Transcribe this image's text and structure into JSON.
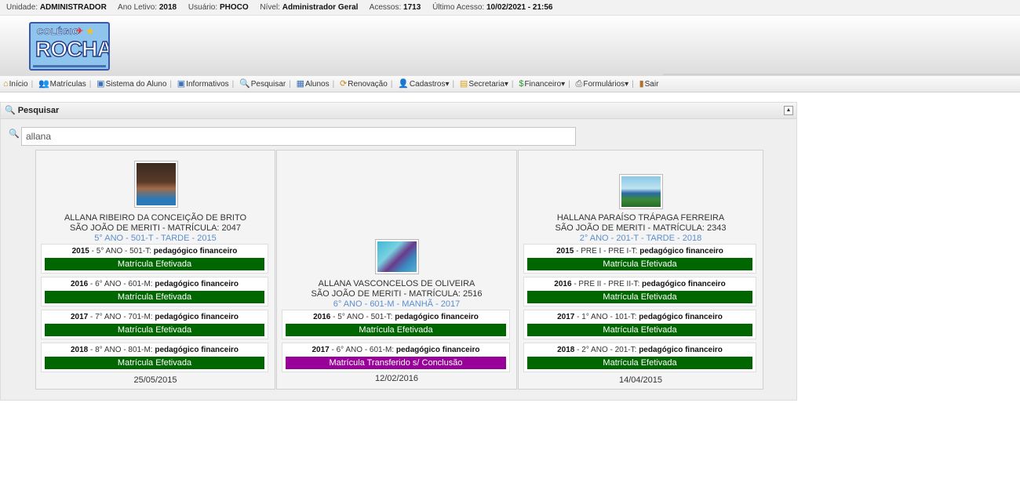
{
  "topbar": {
    "unit_label": "Unidade:",
    "unit": "ADMINISTRADOR",
    "year_label": "Ano Letivo:",
    "year": "2018",
    "user_label": "Usuário:",
    "user": "PHOCO",
    "level_label": "Nível:",
    "level": "Administrador Geral",
    "access_label": "Acessos:",
    "access": "1713",
    "last_label": "Último Acesso:",
    "last": "10/02/2021 - 21:56"
  },
  "logo": {
    "line1": "COLÉGIO",
    "line2": "ROCHA"
  },
  "nav": {
    "inicio": "Início",
    "matriculas": "Matrículas",
    "sistema": "Sistema do Aluno",
    "informativos": "Informativos",
    "pesquisar": "Pesquisar",
    "alunos": "Alunos",
    "renovacao": "Renovação",
    "cadastros": "Cadastros▾",
    "secretaria": "Secretaria▾",
    "financeiro": "Financeiro▾",
    "formularios": "Formulários▾",
    "sair": "Sair"
  },
  "panel": {
    "title": "Pesquisar"
  },
  "search": {
    "value": "allana"
  },
  "colors": {
    "effective": "#006600",
    "transferred": "#990099",
    "class_text": "#5a8ed0"
  },
  "students": [
    {
      "name": "ALLANA RIBEIRO DA CONCEIÇÃO DE BRITO",
      "registration": "SÃO JOÃO DE MERITI - MATRÍCULA: 2047",
      "class": "5° ANO - 501-T - TARDE - 2015",
      "enrollments": [
        {
          "year": "2015",
          "desc": " - 5° ANO - 501-T: ",
          "links": "pedagógico financeiro",
          "status": "Matrícula Efetivada"
        },
        {
          "year": "2016",
          "desc": " - 6° ANO - 601-M: ",
          "links": "pedagógico financeiro",
          "status": "Matrícula Efetivada"
        },
        {
          "year": "2017",
          "desc": " - 7° ANO - 701-M: ",
          "links": "pedagógico financeiro",
          "status": "Matrícula Efetivada"
        },
        {
          "year": "2018",
          "desc": " - 8° ANO - 801-M: ",
          "links": "pedagógico financeiro",
          "status": "Matrícula Efetivada"
        }
      ],
      "date": "25/05/2015"
    },
    {
      "name": "ALLANA VASCONCELOS DE OLIVEIRA",
      "registration": "SÃO JOÃO DE MERITI - MATRÍCULA: 2516",
      "class": "6° ANO - 601-M - MANHÃ - 2017",
      "enrollments": [
        {
          "year": "2016",
          "desc": " - 5° ANO - 501-T: ",
          "links": "pedagógico financeiro",
          "status": "Matrícula Efetivada"
        },
        {
          "year": "2017",
          "desc": " - 6° ANO - 601-M: ",
          "links": "pedagógico financeiro",
          "status": "Matrícula Transferido s/ Conclusão"
        }
      ],
      "date": "12/02/2016"
    },
    {
      "name": "HALLANA PARAÍSO TRÁPAGA FERREIRA",
      "registration": "SÃO JOÃO DE MERITI - MATRÍCULA: 2343",
      "class": "2° ANO - 201-T - TARDE - 2018",
      "enrollments": [
        {
          "year": "2015",
          "desc": " - PRE I - PRE I-T: ",
          "links": "pedagógico financeiro",
          "status": "Matrícula Efetivada"
        },
        {
          "year": "2016",
          "desc": " - PRE II - PRE II-T: ",
          "links": "pedagógico financeiro",
          "status": "Matrícula Efetivada"
        },
        {
          "year": "2017",
          "desc": " - 1° ANO - 101-T: ",
          "links": "pedagógico financeiro",
          "status": "Matrícula Efetivada"
        },
        {
          "year": "2018",
          "desc": " - 2° ANO - 201-T: ",
          "links": "pedagógico financeiro",
          "status": "Matrícula Efetivada"
        }
      ],
      "date": "14/04/2015"
    }
  ]
}
